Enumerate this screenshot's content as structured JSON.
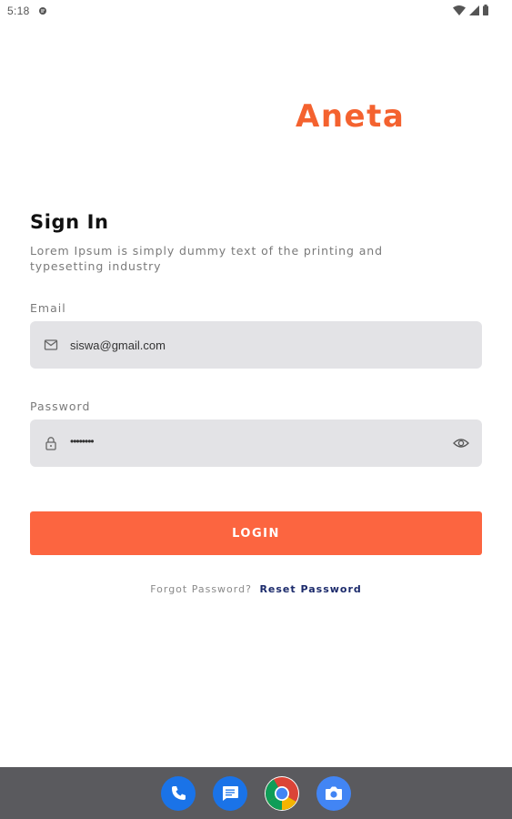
{
  "status_bar": {
    "time": "5:18",
    "icons": [
      "notification-icon",
      "wifi-icon",
      "signal-icon",
      "battery-icon"
    ]
  },
  "brand": {
    "name": "Aneta",
    "color": "#f4622f"
  },
  "signin": {
    "title": "Sign In",
    "subtitle": "Lorem Ipsum is simply dummy text of the printing and typesetting industry"
  },
  "email": {
    "label": "Email",
    "value": "siswa@gmail.com",
    "icon": "mail-icon"
  },
  "password": {
    "label": "Password",
    "value": "••••••••",
    "icon": "lock-icon",
    "toggle_icon": "eye-icon"
  },
  "login_button": {
    "label": "LOGIN",
    "color": "#fc6540"
  },
  "forgot": {
    "question": "Forgot Password?",
    "link": "Reset Password",
    "link_color": "#1b2a6b"
  },
  "nav_bar": {
    "apps": [
      "phone-app-icon",
      "messages-app-icon",
      "chrome-app-icon",
      "camera-app-icon"
    ]
  }
}
